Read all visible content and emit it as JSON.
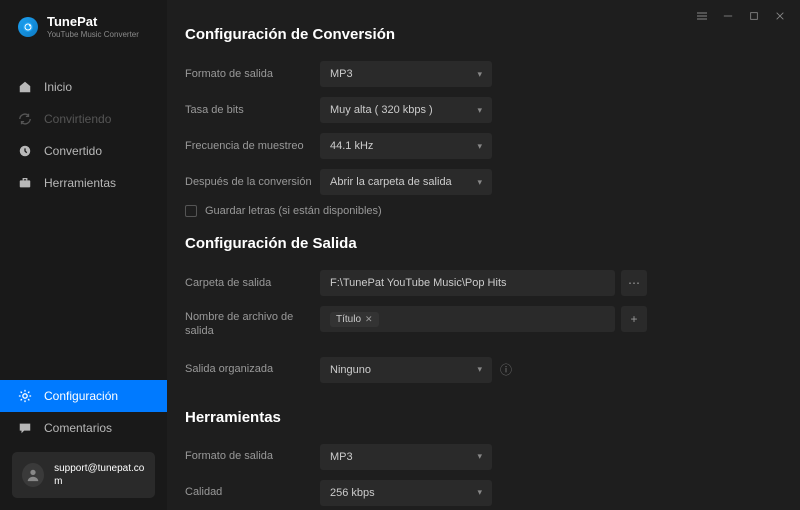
{
  "brand": {
    "name": "TunePat",
    "subtitle": "YouTube Music Converter"
  },
  "titlebar": {
    "menu": "≡",
    "min": "—",
    "max": "☐",
    "close": "✕"
  },
  "nav": {
    "home": "Inicio",
    "converting": "Convirtiendo",
    "converted": "Convertido",
    "tools": "Herramientas",
    "settings": "Configuración",
    "feedback": "Comentarios"
  },
  "account": {
    "email": "support@tunepat.com"
  },
  "sections": {
    "conversion": {
      "title": "Configuración de Conversión",
      "format_label": "Formato de salida",
      "format_value": "MP3",
      "bitrate_label": "Tasa de bits",
      "bitrate_value": "Muy alta ( 320 kbps )",
      "samplerate_label": "Frecuencia de muestreo",
      "samplerate_value": "44.1 kHz",
      "after_label": "Después de la conversión",
      "after_value": "Abrir la carpeta de salida",
      "lyrics_label": "Guardar letras (si están disponibles)"
    },
    "output": {
      "title": "Configuración de Salida",
      "folder_label": "Carpeta de salida",
      "folder_value": "F:\\TunePat YouTube Music\\Pop Hits",
      "filename_label": "Nombre de archivo de salida",
      "filename_tag": "Título",
      "organized_label": "Salida organizada",
      "organized_value": "Ninguno"
    },
    "tools": {
      "title": "Herramientas",
      "format_label": "Formato de salida",
      "format_value": "MP3",
      "quality_label": "Calidad",
      "quality_value": "256 kbps"
    }
  }
}
